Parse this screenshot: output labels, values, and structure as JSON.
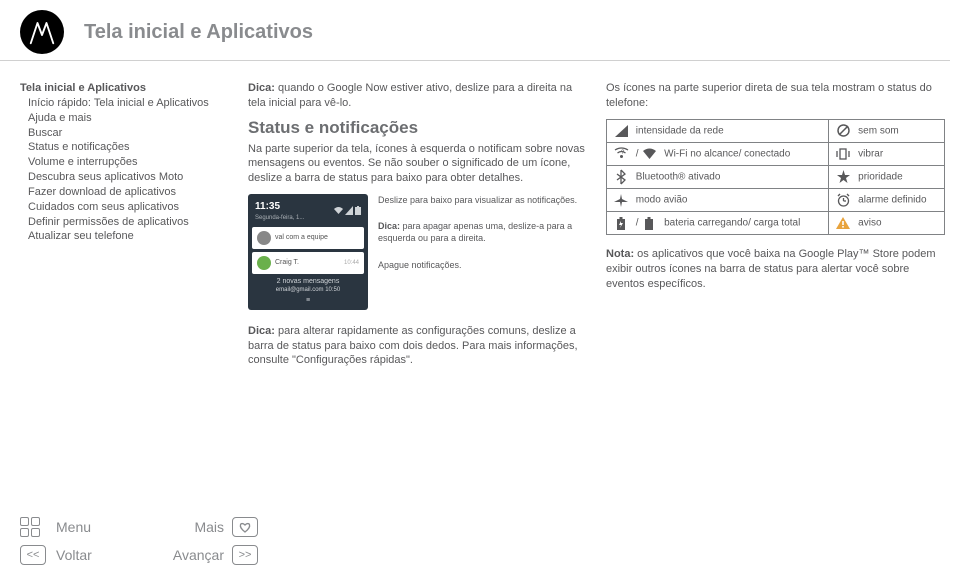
{
  "header": {
    "page_title": "Tela inicial e Aplicativos"
  },
  "sidebar": {
    "title": "Tela inicial e Aplicativos",
    "items": [
      "Início rápido: Tela inicial e Aplicativos",
      "Ajuda e mais",
      "Buscar",
      "Status e notificações",
      "Volume e interrupções",
      "Descubra seus aplicativos Moto",
      "Fazer download de aplicativos",
      "Cuidados com seus aplicativos",
      "Definir permissões de aplicativos",
      "Atualizar seu telefone"
    ]
  },
  "main": {
    "tip1_label": "Dica:",
    "tip1_text": " quando o Google Now estiver ativo, deslize para a direita na tela inicial para vê-lo.",
    "section_title": "Status e notificações",
    "section_body": "Na parte superior da tela, ícones à esquerda o notificam sobre novas mensagens ou eventos. Se não souber o significado de um ícone, deslize a barra de status para baixo para obter detalhes.",
    "annot1": "Deslize para baixo para visualizar as notificações.",
    "annot2_label": "Dica:",
    "annot2_text": " para apagar apenas uma, deslize-a para a esquerda ou para a direita.",
    "annot3": "Apague notificações.",
    "tip2_label": "Dica:",
    "tip2_text": " para alterar rapidamente as configurações comuns, deslize a barra de status para baixo com dois dedos. Para mais informações, consulte \"Configurações rápidas\".",
    "phone": {
      "time": "11:35",
      "date": "Segunda-feira, 1...",
      "n1": "val com a equipe",
      "n2_from": "Craig T.",
      "n2_time": "10:44",
      "footer_count": "2 novas mensagens",
      "footer_sub": "email@gmail.com    10:50"
    }
  },
  "right": {
    "intro": "Os ícones na parte superior direta de sua tela mostram o status do telefone:",
    "rows": [
      {
        "l": "intensidade da rede",
        "r": "sem som"
      },
      {
        "l": "Wi-Fi no alcance/ conectado",
        "r": "vibrar",
        "lprefix": " / "
      },
      {
        "l": "Bluetooth® ativado",
        "r": "prioridade"
      },
      {
        "l": "modo avião",
        "r": "alarme definido"
      },
      {
        "l": "bateria carregando/ carga total",
        "r": "aviso",
        "lprefix": " / "
      }
    ],
    "note_label": "Nota:",
    "note_text": " os aplicativos que você baixa na Google Play™ Store podem exibir outros ícones na barra de status para alertar você sobre eventos específicos."
  },
  "footer": {
    "menu": "Menu",
    "mais": "Mais",
    "voltar": "Voltar",
    "avancar": "Avançar"
  }
}
